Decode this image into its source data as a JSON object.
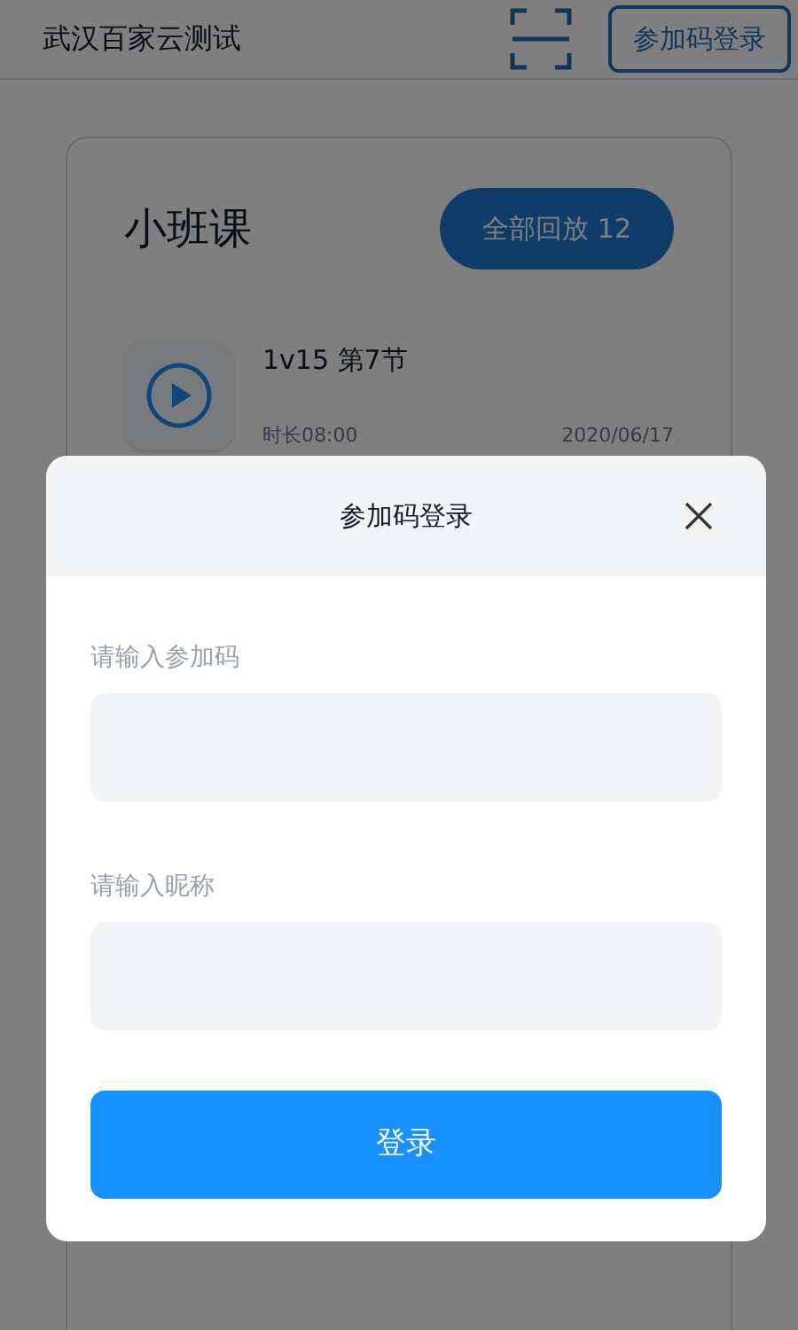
{
  "header": {
    "title": "武汉百家云测试",
    "join_button": "参加码登录"
  },
  "course_card": {
    "title": "小班课",
    "replay_button": "全部回放 12",
    "lessons": [
      {
        "title": "1v15 第7节",
        "duration": "时长08:00",
        "date": "2020/06/17"
      }
    ]
  },
  "dialog": {
    "title": "参加码登录",
    "fields": [
      {
        "label": "请输入参加码"
      },
      {
        "label": "请输入昵称"
      }
    ],
    "submit": "登录"
  }
}
